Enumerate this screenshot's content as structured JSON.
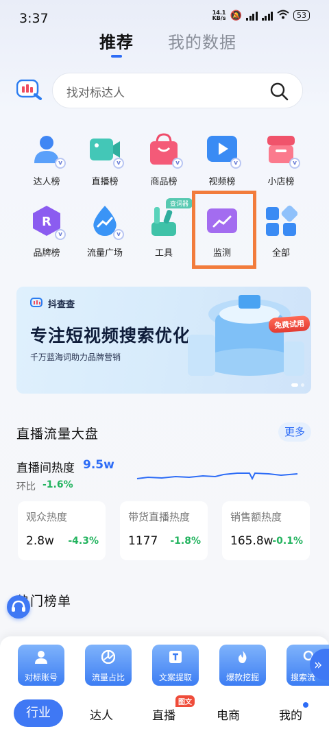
{
  "status_bar": {
    "time": "3:37",
    "net_speed": "14.1\nKB/s",
    "battery": "53"
  },
  "top_tabs": [
    {
      "label": "推荐",
      "active": true
    },
    {
      "label": "我的数据",
      "active": false
    }
  ],
  "search": {
    "placeholder": "找对标达人"
  },
  "categories": [
    {
      "label": "达人榜",
      "icon": "person-icon"
    },
    {
      "label": "直播榜",
      "icon": "video-camera-icon"
    },
    {
      "label": "商品榜",
      "icon": "shopping-bag-icon"
    },
    {
      "label": "视频榜",
      "icon": "play-icon"
    },
    {
      "label": "小店榜",
      "icon": "store-icon"
    },
    {
      "label": "品牌榜",
      "icon": "brand-hexagon-icon"
    },
    {
      "label": "流量广场",
      "icon": "flow-drop-icon"
    },
    {
      "label": "工具",
      "icon": "tools-icon",
      "tag": "查词器"
    },
    {
      "label": "监测",
      "icon": "monitor-chart-icon"
    },
    {
      "label": "全部",
      "icon": "grid-icon"
    }
  ],
  "banner": {
    "brand": "抖查查",
    "title": "专注短视频搜索优化",
    "subtitle": "千万蓝海词助力品牌营销",
    "trial": "免费试用"
  },
  "live_section": {
    "title": "直播流量大盘",
    "more": "更多",
    "heat_label": "直播间热度",
    "heat_value": "9.5w",
    "hb_label": "环比",
    "hb_value": "-1.6%",
    "cards": [
      {
        "title": "观众热度",
        "value": "2.8w",
        "delta": "-4.3%"
      },
      {
        "title": "带货直播热度",
        "value": "1177",
        "delta": "-1.8%"
      },
      {
        "title": "销售额热度",
        "value": "165.8w",
        "delta": "-0.1%"
      }
    ]
  },
  "hot_section": {
    "title": "热门榜单"
  },
  "tools": [
    {
      "label": "对标账号"
    },
    {
      "label": "流量占比"
    },
    {
      "label": "文案提取"
    },
    {
      "label": "爆款挖掘"
    },
    {
      "label": "搜索流"
    }
  ],
  "nav": {
    "items": [
      "行业",
      "达人",
      "直播",
      "电商",
      "我的"
    ],
    "live_tag": "图文"
  },
  "colors": {
    "accent": "#2d6cf6",
    "positive": "#22b35e",
    "highlight": "#f27c3c"
  }
}
